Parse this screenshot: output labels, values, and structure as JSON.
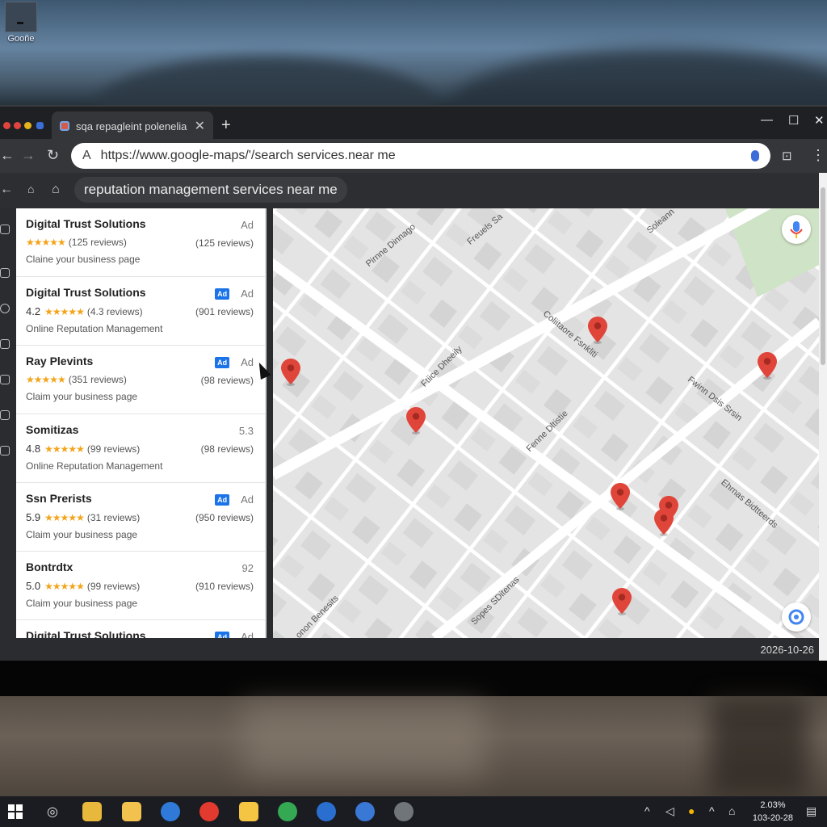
{
  "desktop": {
    "icon_label": "Gooñe"
  },
  "browser": {
    "tab_title": "sqa repagleint polenelia",
    "url": "https://www.google-maps/'/search services.near me"
  },
  "maps": {
    "search_query": "reputation management services near me",
    "results": [
      {
        "name": "Digital Trust Solutions",
        "ad_label": "Ad",
        "show_badge": false,
        "rating": "",
        "review_count": "(125 reviews)",
        "review_count_right": "(125 reviews)",
        "subtitle": "Claine your business page"
      },
      {
        "name": "Digital Trust Solutions",
        "ad_label": "Ad",
        "show_badge": true,
        "badge": "Ad",
        "rating": "4.2",
        "review_count": "(4.3 reviews)",
        "review_count_right": "(901 reviews)",
        "subtitle": "Online Reputation Management"
      },
      {
        "name": "Ray Plevints",
        "ad_label": "Ad",
        "show_badge": true,
        "badge": "Ad",
        "rating": "",
        "review_count": "(351 reviews)",
        "review_count_right": "(98 reviews)",
        "subtitle": "Claim your business page"
      },
      {
        "name": "Somitizas",
        "ad_label": "5.3",
        "show_badge": false,
        "rating": "4.8",
        "review_count": "(99 reviews)",
        "review_count_right": "(98 reviews)",
        "subtitle": "Online Reputation Management"
      },
      {
        "name": "Ssn Prerists",
        "ad_label": "Ad",
        "show_badge": true,
        "badge": "Ad",
        "rating": "5.9",
        "review_count": "(31 reviews)",
        "review_count_right": "(950 reviews)",
        "subtitle": "Claim your business page"
      },
      {
        "name": "Bontrdtx",
        "ad_label": "92",
        "show_badge": false,
        "rating": "5.0",
        "review_count": "(99 reviews)",
        "review_count_right": "(910 reviews)",
        "subtitle": "Claim your business page"
      },
      {
        "name": "Digital Trust Solutions",
        "ad_label": "Ad",
        "show_badge": true,
        "badge": "Ad",
        "rating": "",
        "review_count": "",
        "review_count_right": "",
        "subtitle": ""
      }
    ],
    "street_labels": [
      "Pirnne Dinnago",
      "Freuels Sa",
      "Soleann",
      "Coliitaore Fsnkliti",
      "Ftiice Dheeily",
      "Fwinn Dsis Srsin",
      "Fenne Dltistie",
      "Ehrnas Bidtteerds",
      "Sopes SDitenas",
      "onon Benesits"
    ],
    "status_date": "2026-10-26"
  },
  "taskbar": {
    "clock_top": "2.03%",
    "clock_bottom": "103-20-28"
  }
}
